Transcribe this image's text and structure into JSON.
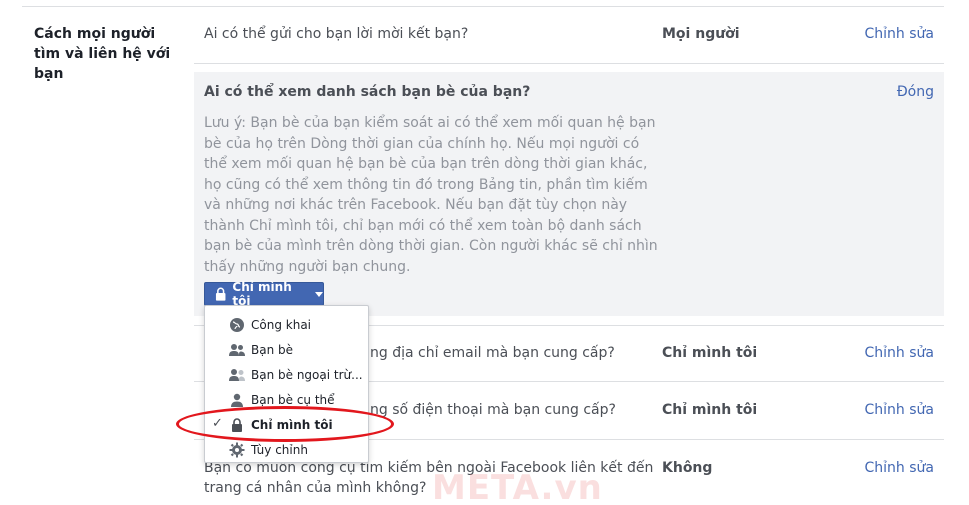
{
  "section": {
    "label": "Cách mọi người tìm và liên hệ với bạn"
  },
  "rows": [
    {
      "question": "Ai có thể gửi cho bạn lời mời kết bạn?",
      "value": "Mọi người",
      "edit": "Chỉnh sửa"
    },
    {
      "question": "ng địa chỉ email mà bạn cung cấp?",
      "value": "Chỉ mình tôi",
      "edit": "Chỉnh sửa"
    },
    {
      "question": "ng số điện thoại mà bạn cung cấp?",
      "value": "Chỉ mình tôi",
      "edit": "Chỉnh sửa"
    },
    {
      "question_line1": "Bạn có muốn công cụ tìm kiếm bên ngoài Facebook liên kết đến",
      "question_line2": "trang cá nhân của mình không?",
      "value": "Không",
      "edit": "Chỉnh sửa"
    }
  ],
  "expanded": {
    "title": "Ai có thể xem danh sách bạn bè của bạn?",
    "close": "Đóng",
    "note": "Lưu ý: Bạn bè của bạn kiểm soát ai có thể xem mối quan hệ bạn bè của họ trên Dòng thời gian của chính họ. Nếu mọi người có thể xem mối quan hệ bạn bè của bạn trên dòng thời gian khác, họ cũng có thể xem thông tin đó trong Bảng tin, phần tìm kiếm và những nơi khác trên Facebook. Nếu bạn đặt tùy chọn này thành Chỉ mình tôi, chỉ bạn mới có thể xem toàn bộ danh sách bạn bè của mình trên dòng thời gian. Còn người khác sẽ chỉ nhìn thấy những người bạn chung.",
    "button_label": "Chỉ mình tôi"
  },
  "menu": {
    "items": [
      {
        "label": "Công khai",
        "icon": "globe-icon"
      },
      {
        "label": "Bạn bè",
        "icon": "friends-icon"
      },
      {
        "label": "Bạn bè ngoại trừ...",
        "icon": "friends-except-icon"
      },
      {
        "label": "Bạn bè cụ thể",
        "icon": "specific-friend-icon"
      },
      {
        "label": "Chỉ mình tôi",
        "icon": "lock-icon",
        "selected": true
      },
      {
        "label": "Tùy chỉnh",
        "icon": "gear-icon"
      }
    ],
    "check": "✓"
  },
  "watermark": "META.vn",
  "colors": {
    "link": "#4267b2",
    "button": "#4267b2",
    "highlight": "#e2171d",
    "panel": "#f2f3f5"
  }
}
